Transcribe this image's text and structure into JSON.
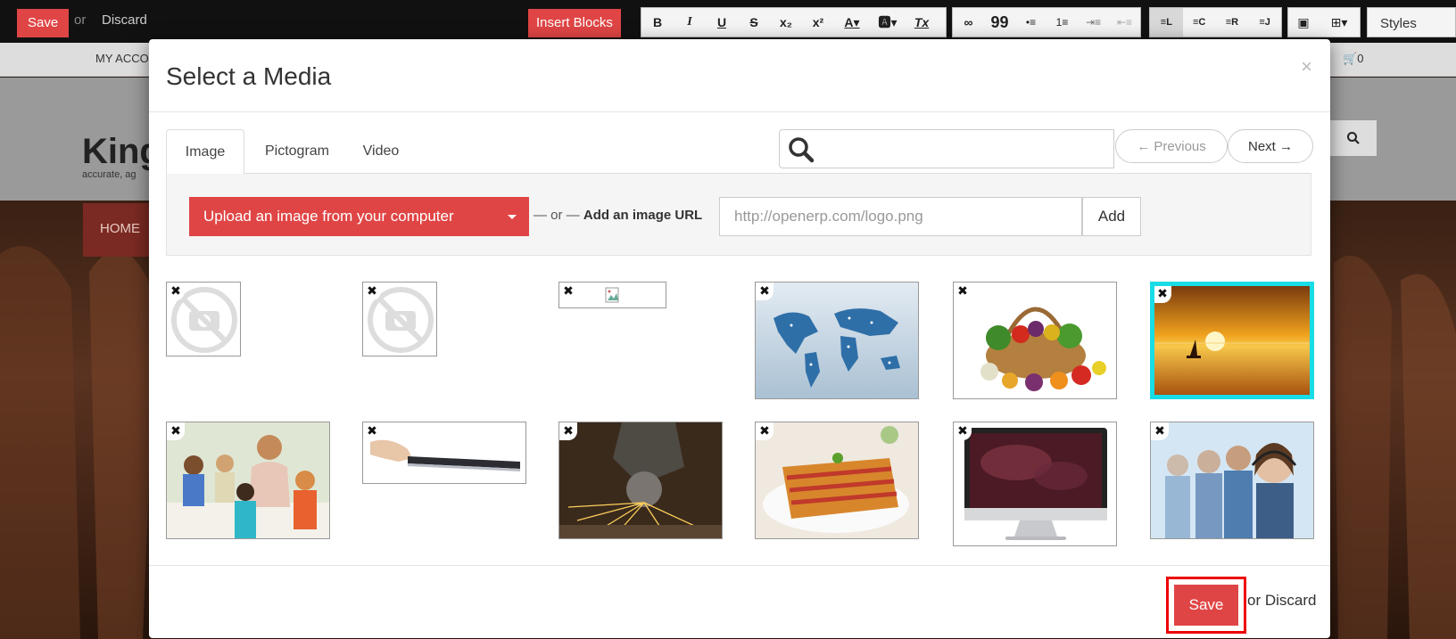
{
  "toolbar": {
    "save_label": "Save",
    "or_label": "or",
    "discard_label": "Discard",
    "insert_blocks_label": "Insert Blocks",
    "styles_label": "Styles",
    "format_buttons": [
      "B",
      "I",
      "U",
      "S",
      "x₂",
      "x²",
      "A▾",
      "🅰▾",
      "Tx"
    ],
    "insert_buttons": [
      "∞",
      "99",
      "•≡",
      "1≡",
      "⇥≡",
      "⇤≡"
    ],
    "align_buttons": [
      "≡L",
      "≡C",
      "≡R",
      "≡J"
    ],
    "media_buttons": [
      "▣",
      "⊞▾"
    ]
  },
  "background_page": {
    "my_account": "MY ACCO",
    "cart": "0",
    "logo": "Kingf",
    "tagline": "accurate, ag",
    "menu_home": "HOME"
  },
  "modal": {
    "title": "Select a Media",
    "close": "×",
    "tabs": [
      {
        "label": "Image",
        "active": true
      },
      {
        "label": "Pictogram",
        "active": false
      },
      {
        "label": "Video",
        "active": false
      }
    ],
    "search": {
      "value": "",
      "placeholder": ""
    },
    "pager": {
      "previous": "← Previous",
      "next": "Next →"
    },
    "upload": {
      "button_label": "Upload an image from your computer",
      "or_prefix": "— or —",
      "url_label": "Add an image URL",
      "url_placeholder": "http://openerp.com/logo.png",
      "add_label": "Add"
    },
    "thumbnails": [
      {
        "name": "no-image-placeholder-1",
        "selected": false
      },
      {
        "name": "no-image-placeholder-2",
        "selected": false
      },
      {
        "name": "broken-image",
        "selected": false
      },
      {
        "name": "world-map",
        "selected": false
      },
      {
        "name": "vegetable-basket",
        "selected": false
      },
      {
        "name": "sunset-sea",
        "selected": true
      },
      {
        "name": "teacher-children",
        "selected": false
      },
      {
        "name": "tablet-hand",
        "selected": false
      },
      {
        "name": "grinder-sparks",
        "selected": false
      },
      {
        "name": "lasagna",
        "selected": false
      },
      {
        "name": "desktop-monitor",
        "selected": false
      },
      {
        "name": "call-center-team",
        "selected": false
      }
    ],
    "remove_icon": "✖",
    "footer": {
      "save_label": "Save",
      "or_discard_label": "or Discard"
    }
  },
  "colors": {
    "accent_red": "#e04545",
    "selected_border": "#18dce6",
    "highlight_box": "#e00000"
  }
}
